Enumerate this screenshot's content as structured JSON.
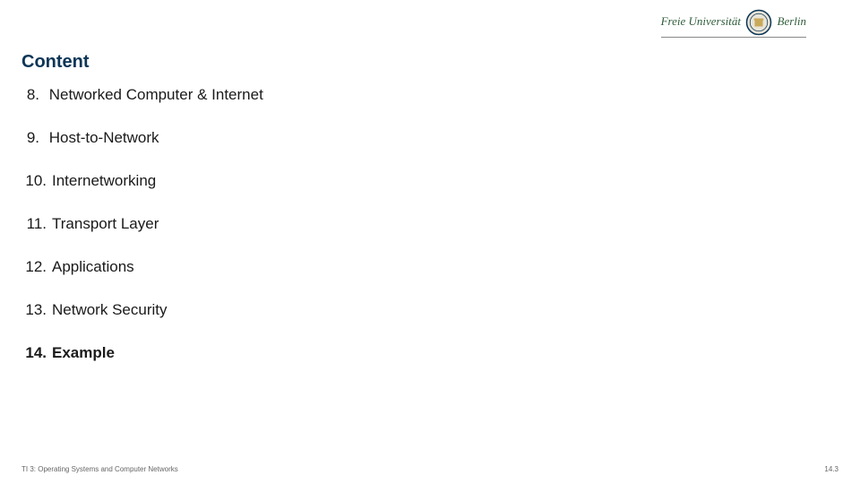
{
  "logo": {
    "part1": "Freie Universität",
    "part2": "Berlin"
  },
  "title": "Content",
  "items": [
    {
      "num": "8.",
      "text": "Networked Computer & Internet",
      "bold": false,
      "narrow": true
    },
    {
      "num": "9.",
      "text": "Host-to-Network",
      "bold": false,
      "narrow": true
    },
    {
      "num": "10.",
      "text": "Internetworking",
      "bold": false,
      "narrow": false
    },
    {
      "num": "11.",
      "text": "Transport Layer",
      "bold": false,
      "narrow": false
    },
    {
      "num": "12.",
      "text": "Applications",
      "bold": false,
      "narrow": false
    },
    {
      "num": "13.",
      "text": "Network Security",
      "bold": false,
      "narrow": false
    },
    {
      "num": "14.",
      "text": "Example",
      "bold": true,
      "narrow": false
    }
  ],
  "footer": {
    "left": "TI 3: Operating Systems and Computer Networks",
    "right": "14.3"
  }
}
